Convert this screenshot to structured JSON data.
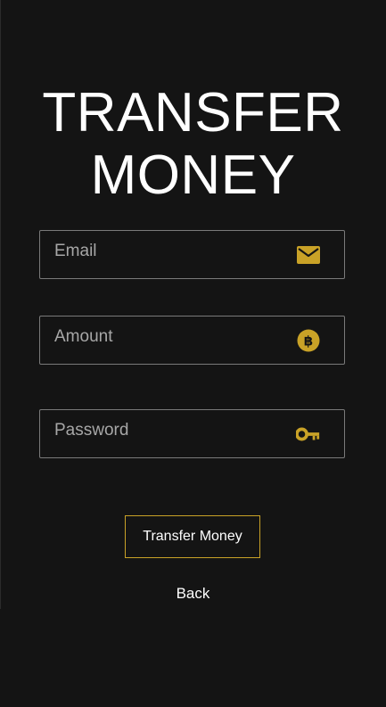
{
  "page": {
    "title_line1": "TRANSFER",
    "title_line2": "MONEY"
  },
  "form": {
    "email": {
      "placeholder": "Email",
      "value": "",
      "icon": "mail-icon"
    },
    "amount": {
      "placeholder": "Amount",
      "value": "",
      "icon": "bitcoin-icon"
    },
    "password": {
      "placeholder": "Password",
      "value": "",
      "icon": "key-icon"
    }
  },
  "actions": {
    "submit_label": "Transfer Money",
    "back_label": "Back"
  },
  "colors": {
    "background": "#141414",
    "accent": "#c9a227",
    "field_border": "#7a7a7a",
    "placeholder": "#a7a7a7",
    "text": "#ffffff"
  }
}
